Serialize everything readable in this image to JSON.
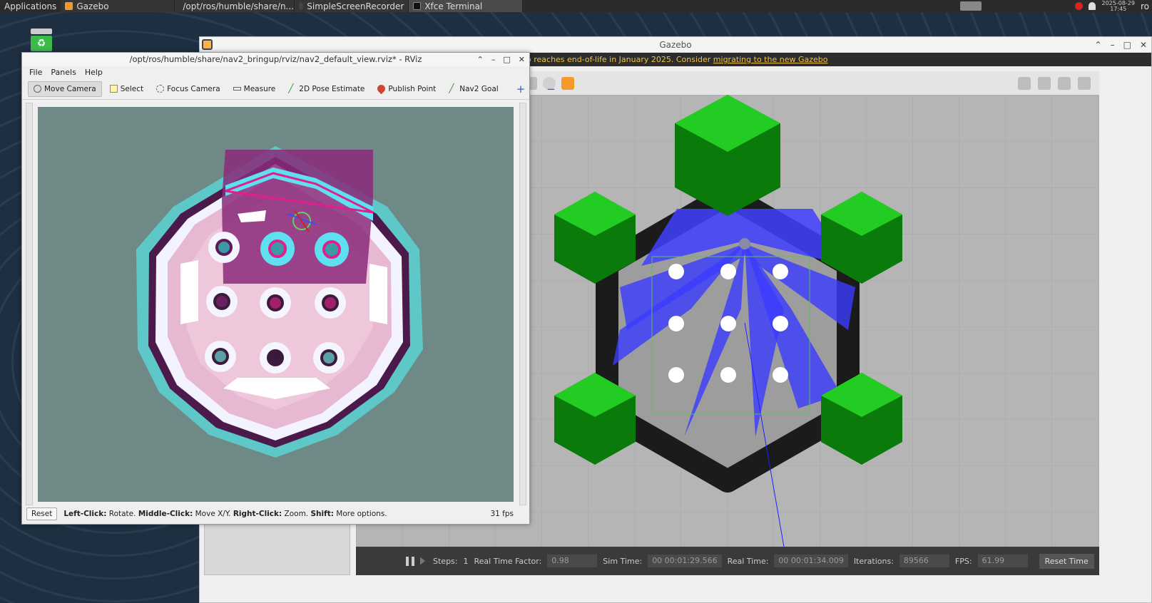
{
  "taskbar": {
    "applications": "Applications",
    "tasks": [
      "Gazebo",
      "/opt/ros/humble/share/n...",
      "SimpleScreenRecorder",
      "Xfce Terminal"
    ],
    "clock_date": "2025-08-29",
    "clock_time": "17:45",
    "user_fragment": "ro"
  },
  "gazebo": {
    "title": "Gazebo",
    "banner_text": "o reaches end-of-life in January 2025. Consider ",
    "banner_link": "migrating to the new Gazebo",
    "bottom": {
      "steps_label": "Steps:",
      "steps_value": "1",
      "rtf_label": "Real Time Factor:",
      "rtf_value": "0.98",
      "sim_time_label": "Sim Time:",
      "sim_time_value": "00 00:01:29.566",
      "real_time_label": "Real Time:",
      "real_time_value": "00 00:01:34.009",
      "iterations_label": "Iterations:",
      "iterations_value": "89566",
      "fps_label": "FPS:",
      "fps_value": "61.99",
      "reset_time": "Reset Time"
    }
  },
  "rviz": {
    "title": "/opt/ros/humble/share/nav2_bringup/rviz/nav2_default_view.rviz* - RViz",
    "menu": [
      "File",
      "Panels",
      "Help"
    ],
    "tools": [
      {
        "label": "Move Camera",
        "icon": "move-camera-icon"
      },
      {
        "label": "Select",
        "icon": "select-icon"
      },
      {
        "label": "Focus Camera",
        "icon": "focus-camera-icon"
      },
      {
        "label": "Measure",
        "icon": "measure-icon"
      },
      {
        "label": "2D Pose Estimate",
        "icon": "pose-estimate-icon"
      },
      {
        "label": "Publish Point",
        "icon": "publish-point-icon"
      },
      {
        "label": "Nav2 Goal",
        "icon": "nav2-goal-icon"
      }
    ],
    "status": {
      "reset": "Reset",
      "left_click": "Left-Click:",
      "left_click_desc": " Rotate. ",
      "middle_click": "Middle-Click:",
      "middle_click_desc": " Move X/Y. ",
      "right_click": "Right-Click:",
      "right_click_desc": " Zoom. ",
      "shift": "Shift:",
      "shift_desc": " More options.",
      "fps": "31 fps"
    }
  }
}
